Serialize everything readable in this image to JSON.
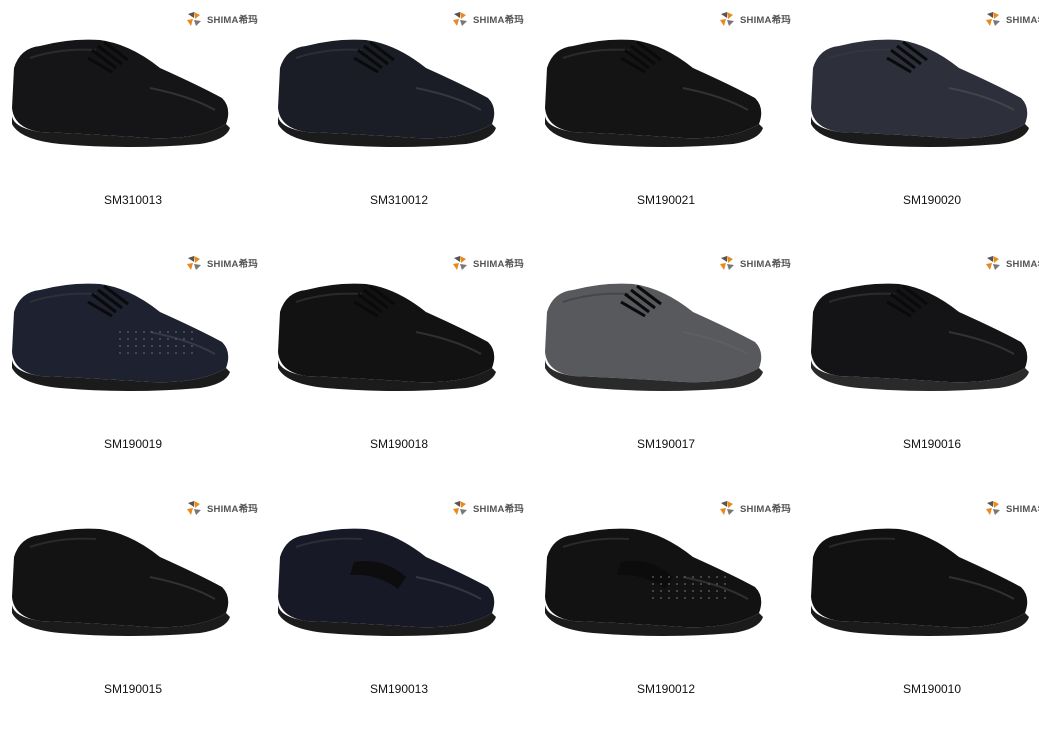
{
  "brand": {
    "logo_text": "SHIMA希玛",
    "accent": "#e8891e"
  },
  "products": [
    {
      "sku": "SM310013",
      "style": "lace-up-derby-chunky",
      "color": "#151517"
    },
    {
      "sku": "SM310012",
      "style": "lace-up-moc-toe",
      "color": "#1a1d26"
    },
    {
      "sku": "SM190021",
      "style": "lace-up-derby-brogue",
      "color": "#141414"
    },
    {
      "sku": "SM190020",
      "style": "lace-up-derby-grey",
      "color": "#2d2f3a"
    },
    {
      "sku": "SM190019",
      "style": "perforated-derby",
      "color": "#1d2130"
    },
    {
      "sku": "SM190018",
      "style": "lace-up-moc-toe",
      "color": "#121212"
    },
    {
      "sku": "SM190017",
      "style": "grey-sneaker",
      "color": "#58595c"
    },
    {
      "sku": "SM190016",
      "style": "black-sneaker",
      "color": "#141416"
    },
    {
      "sku": "SM190015",
      "style": "slip-on-loafer",
      "color": "#131313"
    },
    {
      "sku": "SM190013",
      "style": "penny-loafer-navy",
      "color": "#171a26"
    },
    {
      "sku": "SM190012",
      "style": "perforated-penny-loafer",
      "color": "#121212"
    },
    {
      "sku": "SM190010",
      "style": "plain-slip-on",
      "color": "#111111"
    }
  ]
}
